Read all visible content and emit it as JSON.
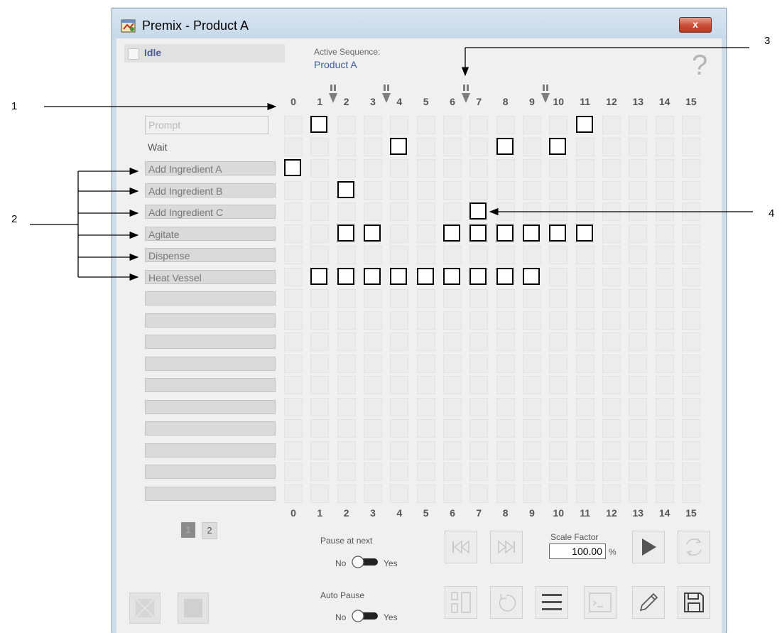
{
  "callouts": [
    "1",
    "2",
    "3",
    "4"
  ],
  "window": {
    "title": "Premix - Product A",
    "close_glyph": "x"
  },
  "status": {
    "text": "Idle",
    "active_sequence_label": "Active Sequence:",
    "active_sequence_value": "Product A",
    "help_glyph": "?"
  },
  "columns": [
    "0",
    "1",
    "2",
    "3",
    "4",
    "5",
    "6",
    "7",
    "8",
    "9",
    "10",
    "11",
    "12",
    "13",
    "14",
    "15"
  ],
  "pause_markers_after_steps": [
    1,
    3,
    6,
    9
  ],
  "rows": [
    {
      "label": "Prompt",
      "style": "prompt",
      "active_steps": [
        1,
        11
      ]
    },
    {
      "label": "Wait",
      "style": "plain",
      "active_steps": [
        4,
        8,
        10
      ]
    },
    {
      "label": "Add Ingredient A",
      "style": "box",
      "active_steps": [
        0
      ]
    },
    {
      "label": "Add Ingredient B",
      "style": "box",
      "active_steps": [
        2
      ]
    },
    {
      "label": "Add Ingredient C",
      "style": "box",
      "active_steps": [
        7
      ]
    },
    {
      "label": "Agitate",
      "style": "box",
      "active_steps": [
        2,
        3,
        6,
        7,
        8,
        9,
        10,
        11
      ]
    },
    {
      "label": "Dispense",
      "style": "box",
      "active_steps": []
    },
    {
      "label": "Heat Vessel",
      "style": "box",
      "active_steps": [
        1,
        2,
        3,
        4,
        5,
        6,
        7,
        8,
        9
      ]
    },
    {
      "label": "",
      "style": "box",
      "active_steps": []
    },
    {
      "label": "",
      "style": "box",
      "active_steps": []
    },
    {
      "label": "",
      "style": "box",
      "active_steps": []
    },
    {
      "label": "",
      "style": "box",
      "active_steps": []
    },
    {
      "label": "",
      "style": "box",
      "active_steps": []
    },
    {
      "label": "",
      "style": "box",
      "active_steps": []
    },
    {
      "label": "",
      "style": "box",
      "active_steps": []
    },
    {
      "label": "",
      "style": "box",
      "active_steps": []
    },
    {
      "label": "",
      "style": "box",
      "active_steps": []
    },
    {
      "label": "",
      "style": "box",
      "active_steps": []
    }
  ],
  "pagination": {
    "page1": "1",
    "page2": "2"
  },
  "controls": {
    "pause_at_next_label": "Pause at next",
    "auto_pause_label": "Auto Pause",
    "no_label": "No",
    "yes_label": "Yes",
    "scale_factor_label": "Scale Factor",
    "scale_factor_value": "100.00",
    "scale_factor_unit": "%"
  },
  "icons": {
    "app": "sequence-app-icon",
    "first_step": "skip-back-icon",
    "last_step": "skip-forward-icon",
    "run": "play-icon",
    "refresh": "refresh-icon",
    "columns": "columns-icon",
    "reset": "reset-icon",
    "menu": "menu-icon",
    "console": "console-icon",
    "edit": "pencil-icon",
    "save": "save-icon"
  }
}
